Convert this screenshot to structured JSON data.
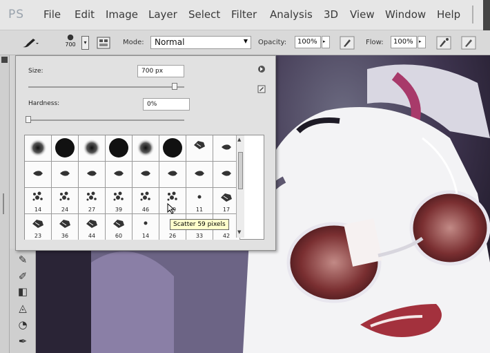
{
  "app": {
    "logo": "PS"
  },
  "menu": [
    {
      "id": "file",
      "label": "File"
    },
    {
      "id": "edit",
      "label": "Edit"
    },
    {
      "id": "image",
      "label": "Image"
    },
    {
      "id": "layer",
      "label": "Layer"
    },
    {
      "id": "select",
      "label": "Select"
    },
    {
      "id": "filter",
      "label": "Filter"
    },
    {
      "id": "analysis",
      "label": "Analysis"
    },
    {
      "id": "3d",
      "label": "3D"
    },
    {
      "id": "view",
      "label": "View"
    },
    {
      "id": "window",
      "label": "Window"
    },
    {
      "id": "help",
      "label": "Help"
    }
  ],
  "options": {
    "brush_size": "700",
    "mode_label": "Mode:",
    "mode_value": "Normal",
    "opacity_label": "Opacity:",
    "opacity_value": "100%",
    "flow_label": "Flow:",
    "flow_value": "100%"
  },
  "brush_picker": {
    "size_label": "Size:",
    "size_value": "700 px",
    "size_level": 0.94,
    "hardness_label": "Hardness:",
    "hardness_value": "0%",
    "hardness_level": 0.0,
    "rows": [
      [
        {
          "kind": "soft",
          "n": ""
        },
        {
          "kind": "hard",
          "n": ""
        },
        {
          "kind": "soft",
          "n": ""
        },
        {
          "kind": "hard",
          "n": ""
        },
        {
          "kind": "soft",
          "n": ""
        },
        {
          "kind": "hard",
          "n": ""
        },
        {
          "kind": "leaf",
          "n": ""
        },
        {
          "kind": "stroke",
          "n": ""
        }
      ],
      [
        {
          "kind": "stroke",
          "n": ""
        },
        {
          "kind": "stroke",
          "n": ""
        },
        {
          "kind": "stroke",
          "n": ""
        },
        {
          "kind": "stroke",
          "n": ""
        },
        {
          "kind": "stroke",
          "n": ""
        },
        {
          "kind": "stroke",
          "n": ""
        },
        {
          "kind": "stroke",
          "n": ""
        },
        {
          "kind": "stroke",
          "n": ""
        }
      ],
      [
        {
          "kind": "scatter",
          "n": "14"
        },
        {
          "kind": "scatter",
          "n": "24"
        },
        {
          "kind": "scatter",
          "n": "27"
        },
        {
          "kind": "scatter",
          "n": "39"
        },
        {
          "kind": "scatter",
          "n": "46"
        },
        {
          "kind": "scatter",
          "n": "59"
        },
        {
          "kind": "dot",
          "n": "11"
        },
        {
          "kind": "leaf",
          "n": "17"
        }
      ],
      [
        {
          "kind": "leaf",
          "n": "23"
        },
        {
          "kind": "leaf",
          "n": "36"
        },
        {
          "kind": "leaf",
          "n": "44"
        },
        {
          "kind": "leaf",
          "n": "60"
        },
        {
          "kind": "dot",
          "n": "14"
        },
        {
          "kind": "dot",
          "n": "26"
        },
        {
          "kind": "dot",
          "n": "33"
        },
        {
          "kind": "dot",
          "n": "42"
        }
      ]
    ],
    "tooltip": "Scatter 59 pixels"
  },
  "colors": {
    "panel": "#e1e1e1",
    "menubar": "#e6e6e6",
    "tooltip": "#ffffcc"
  }
}
